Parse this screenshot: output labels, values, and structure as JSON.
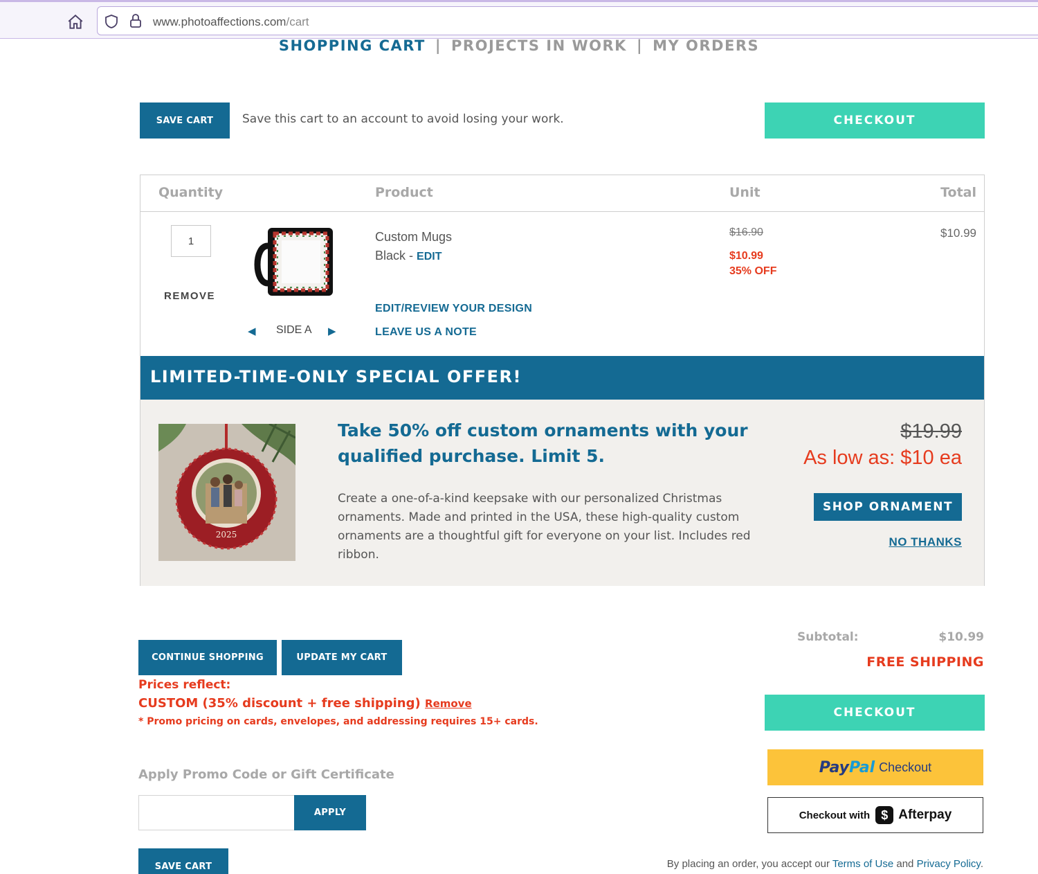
{
  "browser": {
    "url_host": "www.photoaffections.com",
    "url_path": "/cart"
  },
  "nav": {
    "tabs": [
      {
        "label": "SHOPPING CART",
        "active": true
      },
      {
        "label": "PROJECTS IN WORK",
        "active": false
      },
      {
        "label": "MY ORDERS",
        "active": false
      }
    ],
    "separator": "|"
  },
  "top_actions": {
    "save_cart_label": "SAVE CART",
    "save_message": "Save this cart to an account to avoid losing your work.",
    "checkout_label": "CHECKOUT"
  },
  "cart": {
    "headers": {
      "quantity": "Quantity",
      "product": "Product",
      "unit": "Unit",
      "total": "Total"
    },
    "item": {
      "quantity": "1",
      "remove_label": "REMOVE",
      "side_label": "SIDE A",
      "name": "Custom Mugs",
      "variant": "Black",
      "variant_sep": " - ",
      "edit_label": "EDIT",
      "edit_design_label": "EDIT/REVIEW YOUR DESIGN",
      "note_label": "LEAVE US A NOTE",
      "unit_original": "$16.90",
      "unit_price": "$10.99",
      "discount": "35% OFF",
      "total": "$10.99"
    }
  },
  "offer": {
    "banner": "LIMITED-TIME-ONLY SPECIAL OFFER!",
    "headline": "Take 50% off custom ornaments with your qualified purchase. Limit 5.",
    "description": "Create a one-of-a-kind keepsake with our personalized Christmas ornaments. Made and printed in the USA, these high-quality custom ornaments are a thoughtful gift for everyone on your list. Includes red ribbon.",
    "original_price": "$19.99",
    "low_price": "As low as: $10 ea",
    "shop_label": "SHOP ORNAMENT",
    "decline_label": "NO THANKS",
    "ornament_year": "2025"
  },
  "bottom": {
    "continue_label": "CONTINUE SHOPPING",
    "update_label": "UPDATE MY CART",
    "prices_reflect": "Prices reflect:",
    "promo_applied": "CUSTOM (35% discount + free shipping)",
    "promo_remove": "Remove",
    "promo_note": "* Promo pricing on cards, envelopes, and addressing requires 15+ cards.",
    "promo_label": "Apply Promo Code or Gift Certificate",
    "promo_placeholder": "",
    "apply_label": "APPLY",
    "save_cart_label": "SAVE CART"
  },
  "summary": {
    "subtotal_label": "Subtotal:",
    "subtotal_value": "$10.99",
    "shipping": "FREE SHIPPING",
    "checkout_label": "CHECKOUT",
    "paypal_part1": "Pay",
    "paypal_part2": "Pal",
    "paypal_checkout": "Checkout",
    "afterpay_prefix": "Checkout with",
    "afterpay_word": "Afterpay",
    "legal_prefix": "By placing an order, you accept our ",
    "terms_label": "Terms of Use",
    "legal_and": " and ",
    "privacy_label": "Privacy Policy",
    "legal_suffix": "."
  },
  "colors": {
    "brand_blue": "#146a93",
    "teal": "#3dd3b4",
    "sale_red": "#e63b1e",
    "paypal_yellow": "#fcc33a"
  }
}
